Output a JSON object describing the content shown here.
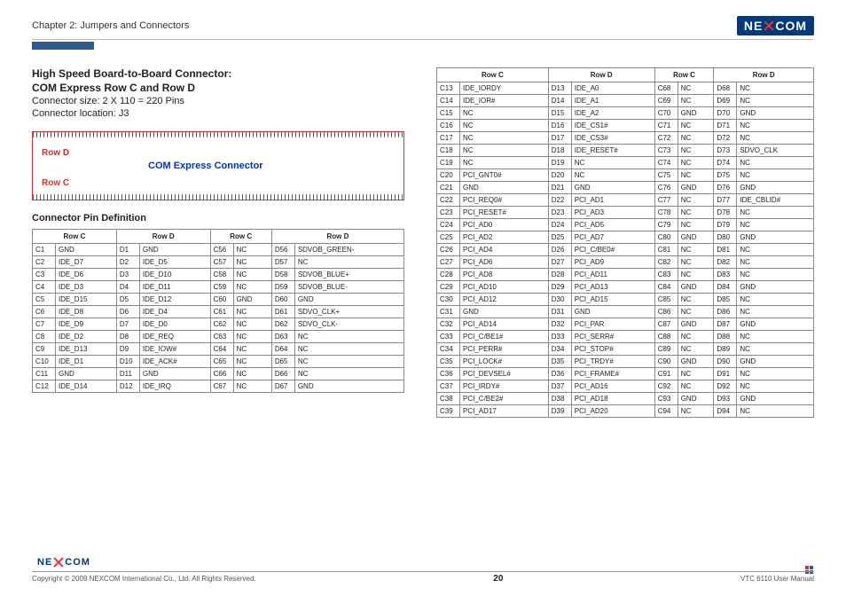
{
  "header": {
    "chapter": "Chapter 2: Jumpers and Connectors",
    "logo_text_1": "NE",
    "logo_text_2": "COM"
  },
  "section": {
    "title1": "High Speed Board-to-Board Connector:",
    "title2": "COM Express Row C and Row D",
    "size": "Connector size: 2 X 110 = 220 Pins",
    "location": "Connector location: J3",
    "diagram_rowd": "Row D",
    "diagram_rowc": "Row C",
    "diagram_title": "COM Express Connector",
    "pins_heading": "Connector Pin Definition"
  },
  "table_headers": {
    "rowc": "Row C",
    "rowd": "Row D"
  },
  "left_table": [
    [
      "C1",
      "GND",
      "D1",
      "GND",
      "C56",
      "NC",
      "D56",
      "SDVOB_GREEN-"
    ],
    [
      "C2",
      "IDE_D7",
      "D2",
      "IDE_D5",
      "C57",
      "NC",
      "D57",
      "NC"
    ],
    [
      "C3",
      "IDE_D6",
      "D3",
      "IDE_D10",
      "C58",
      "NC",
      "D58",
      "SDVOB_BLUE+"
    ],
    [
      "C4",
      "IDE_D3",
      "D4",
      "IDE_D11",
      "C59",
      "NC",
      "D59",
      "SDVOB_BLUE-"
    ],
    [
      "C5",
      "IDE_D15",
      "D5",
      "IDE_D12",
      "C60",
      "GND",
      "D60",
      "GND"
    ],
    [
      "C6",
      "IDE_D8",
      "D6",
      "IDE_D4",
      "C61",
      "NC",
      "D61",
      "SDVO_CLK+"
    ],
    [
      "C7",
      "IDE_D9",
      "D7",
      "IDE_D0",
      "C62",
      "NC",
      "D62",
      "SDVO_CLK-"
    ],
    [
      "C8",
      "IDE_D2",
      "D8",
      "IDE_REQ",
      "C63",
      "NC",
      "D63",
      "NC"
    ],
    [
      "C9",
      "IDE_D13",
      "D9",
      "IDE_IOW#",
      "C64",
      "NC",
      "D64",
      "NC"
    ],
    [
      "C10",
      "IDE_D1",
      "D10",
      "IDE_ACK#",
      "C65",
      "NC",
      "D65",
      "NC"
    ],
    [
      "C11",
      "GND",
      "D11",
      "GND",
      "C66",
      "NC",
      "D66",
      "NC"
    ],
    [
      "C12",
      "IDE_D14",
      "D12",
      "IDE_IRQ",
      "C67",
      "NC",
      "D67",
      "GND"
    ]
  ],
  "right_table": [
    [
      "C13",
      "IDE_IORDY",
      "D13",
      "IDE_A0",
      "C68",
      "NC",
      "D68",
      "NC"
    ],
    [
      "C14",
      "IDE_IOR#",
      "D14",
      "IDE_A1",
      "C69",
      "NC",
      "D69",
      "NC"
    ],
    [
      "C15",
      "NC",
      "D15",
      "IDE_A2",
      "C70",
      "GND",
      "D70",
      "GND"
    ],
    [
      "C16",
      "NC",
      "D16",
      "IDE_CS1#",
      "C71",
      "NC",
      "D71",
      "NC"
    ],
    [
      "C17",
      "NC",
      "D17",
      "IDE_CS3#",
      "C72",
      "NC",
      "D72",
      "NC"
    ],
    [
      "C18",
      "NC",
      "D18",
      "IDE_RESET#",
      "C73",
      "NC",
      "D73",
      "SDVO_CLK"
    ],
    [
      "C19",
      "NC",
      "D19",
      "NC",
      "C74",
      "NC",
      "D74",
      "NC"
    ],
    [
      "C20",
      "PCI_GNT0#",
      "D20",
      "NC",
      "C75",
      "NC",
      "D75",
      "NC"
    ],
    [
      "C21",
      "GND",
      "D21",
      "GND",
      "C76",
      "GND",
      "D76",
      "GND"
    ],
    [
      "C22",
      "PCI_REQ0#",
      "D22",
      "PCI_AD1",
      "C77",
      "NC",
      "D77",
      "IDE_CBLID#"
    ],
    [
      "C23",
      "PCI_RESET#",
      "D23",
      "PCI_AD3",
      "C78",
      "NC",
      "D78",
      "NC"
    ],
    [
      "C24",
      "PCI_AD0",
      "D24",
      "PCI_AD5",
      "C79",
      "NC",
      "D79",
      "NC"
    ],
    [
      "C25",
      "PCI_AD2",
      "D25",
      "PCI_AD7",
      "C80",
      "GND",
      "D80",
      "GND"
    ],
    [
      "C26",
      "PCI_AD4",
      "D26",
      "PCI_C/BE0#",
      "C81",
      "NC",
      "D81",
      "NC"
    ],
    [
      "C27",
      "PCI_AD6",
      "D27",
      "PCI_AD9",
      "C82",
      "NC",
      "D82",
      "NC"
    ],
    [
      "C28",
      "PCI_AD8",
      "D28",
      "PCI_AD11",
      "C83",
      "NC",
      "D83",
      "NC"
    ],
    [
      "C29",
      "PCI_AD10",
      "D29",
      "PCI_AD13",
      "C84",
      "GND",
      "D84",
      "GND"
    ],
    [
      "C30",
      "PCI_AD12",
      "D30",
      "PCI_AD15",
      "C85",
      "NC",
      "D85",
      "NC"
    ],
    [
      "C31",
      "GND",
      "D31",
      "GND",
      "C86",
      "NC",
      "D86",
      "NC"
    ],
    [
      "C32",
      "PCI_AD14",
      "D32",
      "PCI_PAR",
      "C87",
      "GND",
      "D87",
      "GND"
    ],
    [
      "C33",
      "PCI_C/BE1#",
      "D33",
      "PCI_SERR#",
      "C88",
      "NC",
      "D88",
      "NC"
    ],
    [
      "C34",
      "PCI_PERR#",
      "D34",
      "PCI_STOP#",
      "C89",
      "NC",
      "D89",
      "NC"
    ],
    [
      "C35",
      "PCI_LOCK#",
      "D35",
      "PCI_TRDY#",
      "C90",
      "GND",
      "D90",
      "GND"
    ],
    [
      "C36",
      "PCI_DEVSEL#",
      "D36",
      "PCI_FRAME#",
      "C91",
      "NC",
      "D91",
      "NC"
    ],
    [
      "C37",
      "PCI_IRDY#",
      "D37",
      "PCI_AD16",
      "C92",
      "NC",
      "D92",
      "NC"
    ],
    [
      "C38",
      "PCI_C/BE2#",
      "D38",
      "PCI_AD18",
      "C93",
      "GND",
      "D93",
      "GND"
    ],
    [
      "C39",
      "PCI_AD17",
      "D39",
      "PCI_AD20",
      "C94",
      "NC",
      "D94",
      "NC"
    ]
  ],
  "footer": {
    "copyright": "Copyright © 2009 NEXCOM International Co., Ltd. All Rights Reserved.",
    "page": "20",
    "manual": "VTC 6110 User Manual"
  }
}
